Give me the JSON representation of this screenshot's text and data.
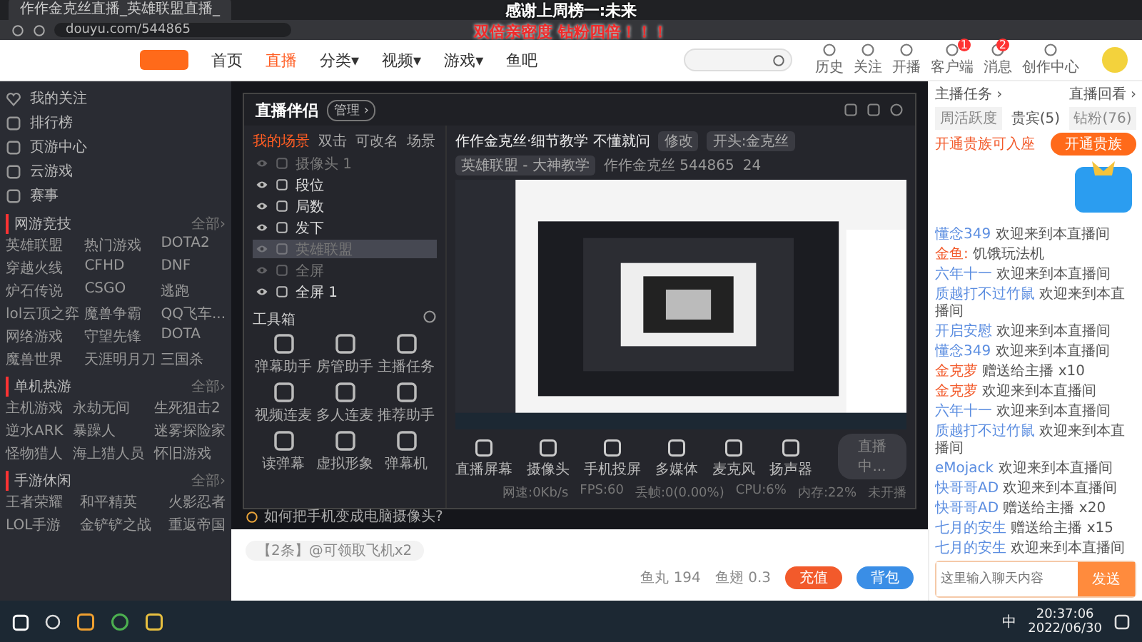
{
  "browser": {
    "tab_title": "作作金克丝直播_英雄联盟直播_",
    "url": "douyu.com/544865"
  },
  "overlay_banner": [
    "感谢上周榜一:未来",
    "双倍亲密度 钻粉四倍！！！"
  ],
  "site_header": {
    "nav": [
      {
        "label": "首页",
        "selected": false
      },
      {
        "label": "直播",
        "selected": true
      },
      {
        "label": "分类▾",
        "selected": false
      },
      {
        "label": "视频▾",
        "selected": false
      },
      {
        "label": "游戏▾",
        "selected": false
      },
      {
        "label": "鱼吧",
        "selected": false
      }
    ],
    "icons": [
      {
        "label": "历史"
      },
      {
        "label": "关注"
      },
      {
        "label": "开播"
      },
      {
        "label": "客户端",
        "badge": "1"
      },
      {
        "label": "消息",
        "badge": "2"
      },
      {
        "label": "创作中心"
      }
    ]
  },
  "sidebar": {
    "items": [
      "我的关注",
      "排行榜",
      "页游中心",
      "云游戏",
      "赛事"
    ],
    "sections": [
      {
        "title": "网游竞技",
        "more": "全部›",
        "games": [
          "英雄联盟",
          "热门游戏",
          "DOTA2",
          "穿越火线",
          "CFHD",
          "DNF",
          "炉石传说",
          "CSGO",
          "逃跑",
          "lol云顶之弈",
          "魔兽争霸",
          "QQ飞车...",
          "网络游戏",
          "守望先锋",
          "DOTA",
          "魔兽世界",
          "天涯明月刀",
          "三国杀"
        ]
      },
      {
        "title": "单机热游",
        "more": "全部›",
        "games": [
          "主机游戏",
          "永劫无间",
          "生死狙击2",
          "逆水ARK",
          "暴躁人",
          "迷雾探险家",
          "怪物猎人",
          "海上猎人员",
          "怀旧游戏"
        ]
      },
      {
        "title": "手游休闲",
        "more": "全部›",
        "games": [
          "王者荣耀",
          "和平精英",
          "火影忍者",
          "LOL手游",
          "金铲铲之战",
          "重返帝国"
        ]
      }
    ]
  },
  "streamer_app": {
    "name": "直播伴侣",
    "badge": "管理 ›",
    "tabs": [
      {
        "label": "我的场景",
        "selected": true
      },
      {
        "label": "双击",
        "selected": false
      },
      {
        "label": "可改名",
        "selected": false
      },
      {
        "label": "场景",
        "selected": false
      }
    ],
    "scenes": [
      {
        "label": "摄像头 1",
        "visible": false,
        "selected": false
      },
      {
        "label": "段位",
        "visible": true,
        "selected": false
      },
      {
        "label": "局数",
        "visible": true,
        "selected": false
      },
      {
        "label": "发下",
        "visible": true,
        "selected": false
      },
      {
        "label": "英雄联盟",
        "visible": false,
        "selected": true
      },
      {
        "label": "全屏",
        "visible": false,
        "selected": false
      },
      {
        "label": "全屏 1",
        "visible": true,
        "selected": false
      }
    ],
    "stream_title": "作作金克丝·细节教学 不懂就问",
    "edit": "修改",
    "notice": "开头:金克丝",
    "category": "英雄联盟 - 大神教学",
    "room": "作作金克丝  544865",
    "viewers": "24",
    "toolbox_title": "工具箱",
    "tools": [
      "弹幕助手",
      "房管助手",
      "主播任务",
      "视频连麦",
      "多人连麦",
      "推荐助手",
      "读弹幕",
      "虚拟形象",
      "弹幕机"
    ],
    "controls": [
      "直播屏幕",
      "摄像头",
      "手机投屏",
      "多媒体",
      "麦克风",
      "扬声器"
    ],
    "go_live": "直播中...",
    "stats": [
      "网速:0Kb/s",
      "FPS:60",
      "丢帧:0(0.00%)",
      "CPU:6%",
      "内存:22%",
      "未开播"
    ],
    "tip": "如何把手机变成电脑摄像头?"
  },
  "chat": {
    "header_links": [
      "主播任务 ›",
      "直播回看 ›"
    ],
    "tabs": [
      {
        "label": "周活跃度",
        "selected": false
      },
      {
        "label": "贵宾(5)",
        "selected": true
      },
      {
        "label": "钻粉(76)",
        "selected": false
      }
    ],
    "hint": "开通贵族可入座",
    "vip_button": "开通贵族",
    "messages": [
      {
        "user": "懂念349",
        "text": "欢迎来到本直播间",
        "color": "#5b8de0"
      },
      {
        "user": "金鱼:",
        "text": "饥饿玩法机",
        "color": "#f25a2b"
      },
      {
        "user": "六年十一",
        "text": "欢迎来到本直播间",
        "color": "#5b8de0"
      },
      {
        "user": "质越打不过竹鼠",
        "text": "欢迎来到本直播间",
        "color": "#5b8de0"
      },
      {
        "user": "开启安慰",
        "text": "欢迎来到本直播间",
        "color": "#5b8de0"
      },
      {
        "user": "懂念349",
        "text": "欢迎来到本直播间",
        "color": "#5b8de0"
      },
      {
        "user": "金克萝",
        "text": "赠送给主播 x10",
        "color": "#f25a2b"
      },
      {
        "user": "金克萝",
        "text": "欢迎来到本直播间",
        "color": "#f25a2b"
      },
      {
        "user": "六年十一",
        "text": "欢迎来到本直播间",
        "color": "#5b8de0"
      },
      {
        "user": "质越打不过竹鼠",
        "text": "欢迎来到本直播间",
        "color": "#5b8de0"
      },
      {
        "user": "eMojack",
        "text": "欢迎来到本直播间",
        "color": "#5b8de0"
      },
      {
        "user": "快哥哥AD",
        "text": "欢迎来到本直播间",
        "color": "#5b8de0"
      },
      {
        "user": "快哥哥AD",
        "text": "赠送给主播 x20",
        "color": "#5b8de0"
      },
      {
        "user": "七月的安生",
        "text": "赠送给主播 x15",
        "color": "#5b8de0"
      },
      {
        "user": "七月的安生",
        "text": "欢迎来到本直播间",
        "color": "#5b8de0"
      }
    ],
    "input_placeholder": "这里输入聊天内容",
    "send": "发送"
  },
  "below_video": {
    "balance": [
      "鱼丸 194",
      "鱼翅 0.3"
    ],
    "recharge": "充值",
    "backpack": "背包",
    "notice": "【2条】@可领取飞机x2"
  },
  "taskbar": {
    "ime": "中",
    "time": "20:37:06",
    "date": "2022/06/30"
  }
}
